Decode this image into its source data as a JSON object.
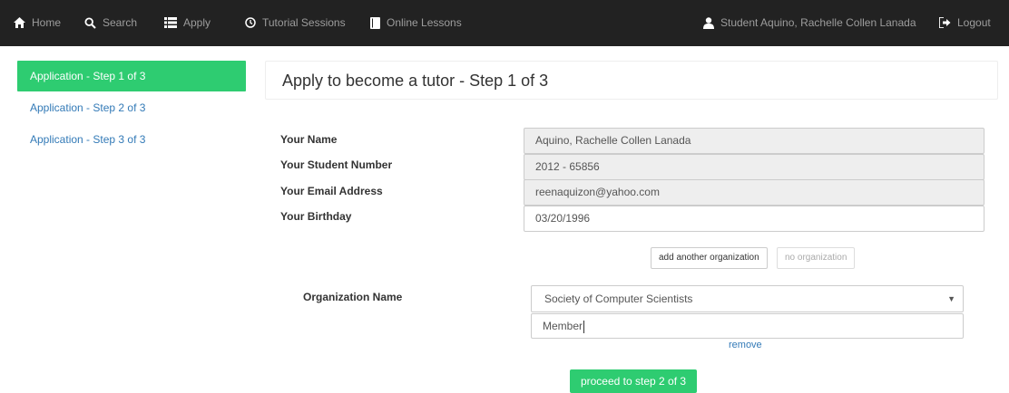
{
  "navbar": {
    "home": "Home",
    "search": "Search",
    "apply": "Apply",
    "tutorial_sessions": "Tutorial Sessions",
    "online_lessons": "Online Lessons",
    "user": "Student Aquino, Rachelle Collen Lanada",
    "logout": "Logout"
  },
  "sidebar": {
    "items": [
      {
        "label": "Application - Step 1 of 3",
        "active": true
      },
      {
        "label": "Application - Step 2 of 3",
        "active": false
      },
      {
        "label": "Application - Step 3 of 3",
        "active": false
      }
    ]
  },
  "page_title": "Apply to become a tutor - Step 1 of 3",
  "form": {
    "name_label": "Your Name",
    "name_value": "Aquino, Rachelle Collen Lanada",
    "student_number_label": "Your Student Number",
    "student_number_value": "2012 - 65856",
    "email_label": "Your Email Address",
    "email_value": "reenaquizon@yahoo.com",
    "birthday_label": "Your Birthday",
    "birthday_value": "03/20/1996"
  },
  "organization": {
    "add_button": "add another organization",
    "none_button": "no organization",
    "label": "Organization Name",
    "selected": "Society of Computer Scientists",
    "position_value": "Member",
    "remove": "remove"
  },
  "proceed_button": "proceed to step 2 of 3",
  "colors": {
    "navbar_bg": "#222222",
    "accent_green": "#2ecc71",
    "link_blue": "#337ab7"
  }
}
